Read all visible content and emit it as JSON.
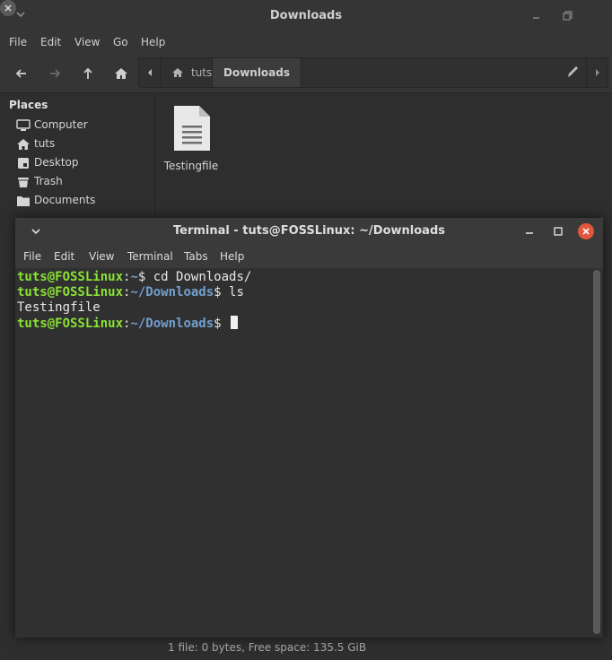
{
  "file_manager": {
    "title": "Downloads",
    "menu": [
      "File",
      "Edit",
      "View",
      "Go",
      "Help"
    ],
    "pathbar": {
      "home_label": "tuts",
      "current_label": "Downloads"
    },
    "sidebar": {
      "section_title": "Places",
      "items": [
        {
          "label": "Computer",
          "icon": "computer-icon"
        },
        {
          "label": "tuts",
          "icon": "home-icon"
        },
        {
          "label": "Desktop",
          "icon": "desktop-icon"
        },
        {
          "label": "Trash",
          "icon": "trash-icon"
        },
        {
          "label": "Documents",
          "icon": "folder-icon"
        }
      ]
    },
    "files": [
      {
        "name": "Testingfile",
        "icon": "text-file-icon"
      }
    ],
    "status": "1 file: 0 bytes, Free space: 135.5 GiB"
  },
  "terminal": {
    "title": "Terminal - tuts@FOSSLinux: ~/Downloads",
    "menu": [
      "File",
      "Edit",
      "View",
      "Terminal",
      "Tabs",
      "Help"
    ],
    "lines": [
      {
        "user": "tuts@FOSSLinux",
        "sep": ":",
        "path": "~",
        "rest": "$ cd Downloads/"
      },
      {
        "user": "tuts@FOSSLinux",
        "sep": ":",
        "path": "~/Downloads",
        "rest": "$ ls"
      },
      {
        "output": "Testingfile"
      },
      {
        "user": "tuts@FOSSLinux",
        "sep": ":",
        "path": "~/Downloads",
        "rest": "$ "
      }
    ]
  },
  "colors": {
    "prompt_user": "#8ae234",
    "prompt_path": "#729fcf",
    "close_button": "#e0573c"
  }
}
